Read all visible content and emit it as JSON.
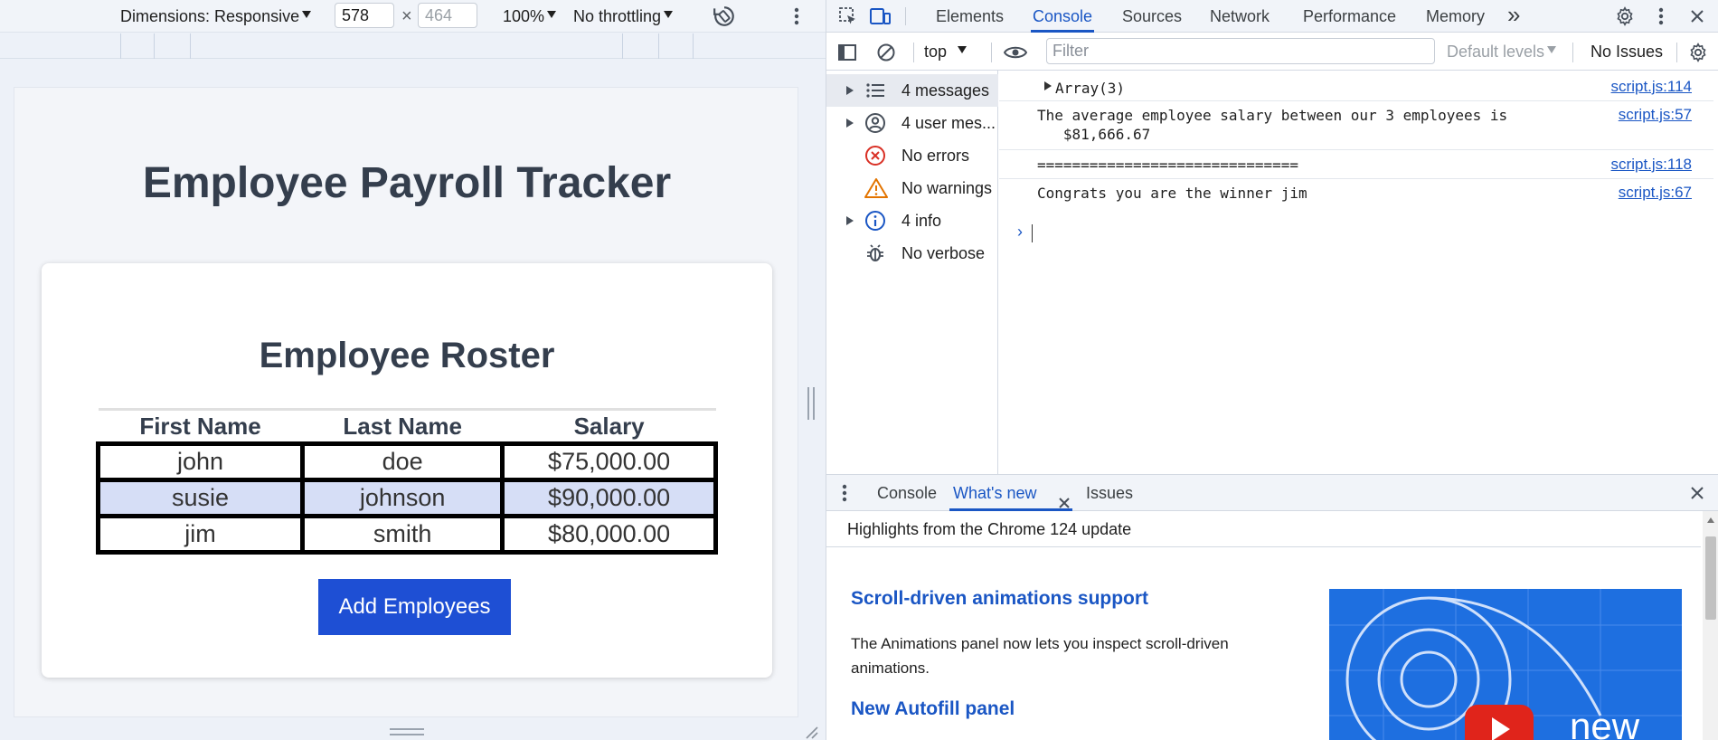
{
  "device_toolbar": {
    "dimensions_label": "Dimensions: Responsive",
    "width_value": "578",
    "times_symbol": "×",
    "height_placeholder": "464",
    "zoom": "100%",
    "throttling": "No throttling"
  },
  "page": {
    "title": "Employee Payroll Tracker",
    "roster_title": "Employee Roster",
    "columns": [
      "First Name",
      "Last Name",
      "Salary"
    ],
    "rows": [
      [
        "john",
        "doe",
        "$75,000.00"
      ],
      [
        "susie",
        "johnson",
        "$90,000.00"
      ],
      [
        "jim",
        "smith",
        "$80,000.00"
      ]
    ],
    "add_button": "Add Employees"
  },
  "devtools": {
    "tabs": [
      "Elements",
      "Console",
      "Sources",
      "Network",
      "Performance",
      "Memory"
    ],
    "more_tabs": "»",
    "active_tab": "Console",
    "console_toolbar": {
      "context": "top",
      "filter_placeholder": "Filter",
      "levels": "Default levels",
      "issues": "No Issues"
    },
    "sidebar": [
      {
        "label": "4 messages",
        "icon": "list-icon"
      },
      {
        "label": "4 user mes...",
        "icon": "user-icon"
      },
      {
        "label": "No errors",
        "icon": "error-icon"
      },
      {
        "label": "No warnings",
        "icon": "warning-icon"
      },
      {
        "label": "4 info",
        "icon": "info-icon"
      },
      {
        "label": "No verbose",
        "icon": "bug-icon"
      }
    ],
    "messages": [
      {
        "text": "Array(3)",
        "source": "script.js:114"
      },
      {
        "text": "The average employee salary between our 3 employees is\n   $81,666.67",
        "source": "script.js:57"
      },
      {
        "text": "==============================",
        "source": "script.js:118"
      },
      {
        "text": "Congrats you are the winner jim",
        "source": "script.js:67"
      }
    ],
    "prompt": "›",
    "drawer": {
      "tabs": [
        "Console",
        "What's new",
        "Issues"
      ],
      "active_tab": "What's new",
      "highlights": "Highlights from the Chrome 124 update",
      "feature1_title": "Scroll-driven animations support",
      "feature1_desc": "The Animations panel now lets you inspect scroll-driven animations.",
      "feature2_title": "New Autofill panel",
      "promo_text": "new"
    }
  },
  "colors": {
    "accent": "#1a56c4",
    "button": "#1e4fd4",
    "row_alt": "#d6def6",
    "error": "#d93025",
    "warning": "#e37400"
  }
}
